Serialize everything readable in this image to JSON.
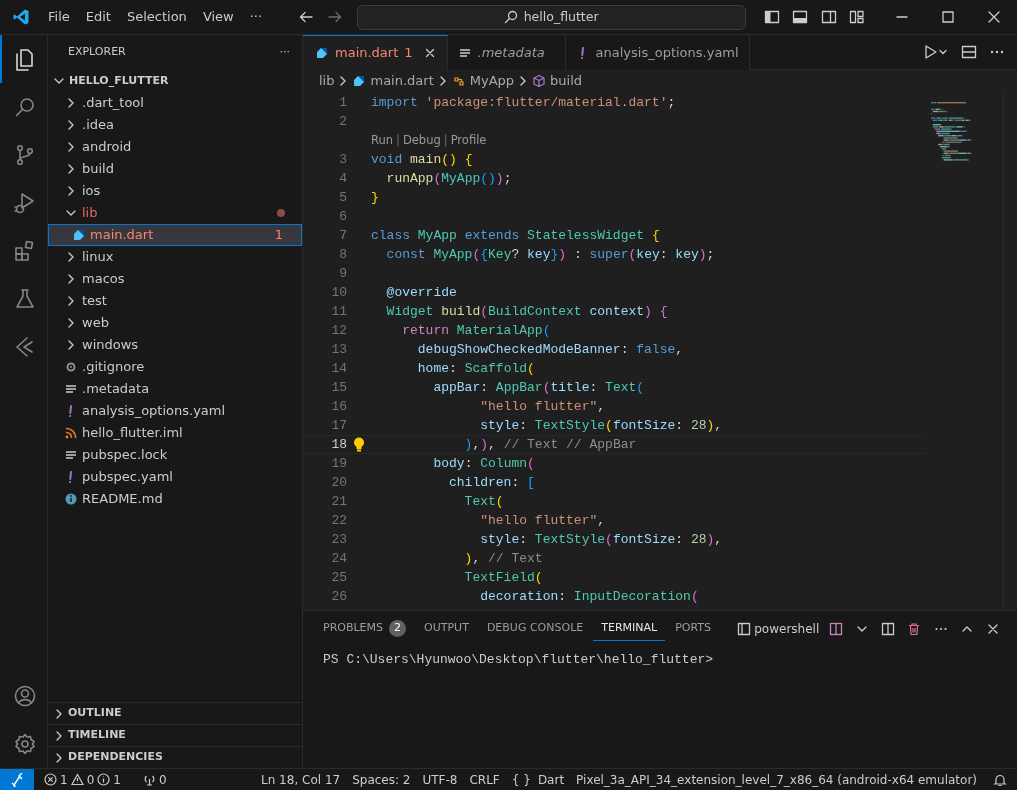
{
  "window": {
    "title": "hello_flutter"
  },
  "menu": [
    "File",
    "Edit",
    "Selection",
    "View"
  ],
  "menu_more": "···",
  "activity_bar": {
    "items": [
      {
        "kind": "explorer",
        "selected": true
      },
      {
        "kind": "search",
        "selected": false
      },
      {
        "kind": "source-control",
        "selected": false
      },
      {
        "kind": "run-debug",
        "selected": false
      },
      {
        "kind": "extensions",
        "selected": false
      },
      {
        "kind": "testing",
        "selected": false
      },
      {
        "kind": "flutter",
        "selected": false
      }
    ],
    "bottom": [
      {
        "kind": "account"
      },
      {
        "kind": "settings"
      }
    ]
  },
  "sidebar": {
    "title": "EXPLORER",
    "more": "···",
    "project": {
      "label": "HELLO_FLUTTER",
      "expanded": true
    },
    "tree": [
      {
        "label": ".dart_tool",
        "kind": "folder",
        "expanded": false,
        "selected": false,
        "error": false
      },
      {
        "label": ".idea",
        "kind": "folder",
        "expanded": false,
        "selected": false,
        "error": false
      },
      {
        "label": "android",
        "kind": "folder",
        "expanded": false,
        "selected": false,
        "error": false
      },
      {
        "label": "build",
        "kind": "folder",
        "expanded": false,
        "selected": false,
        "error": false
      },
      {
        "label": "ios",
        "kind": "folder",
        "expanded": false,
        "selected": false,
        "error": false
      },
      {
        "label": "lib",
        "kind": "folder",
        "expanded": true,
        "selected": false,
        "error": true,
        "children": [
          {
            "label": "main.dart",
            "kind": "dart",
            "selected": true,
            "error": true,
            "badge": "1"
          }
        ]
      },
      {
        "label": "linux",
        "kind": "folder",
        "expanded": false,
        "selected": false,
        "error": false
      },
      {
        "label": "macos",
        "kind": "folder",
        "expanded": false,
        "selected": false,
        "error": false
      },
      {
        "label": "test",
        "kind": "folder",
        "expanded": false,
        "selected": false,
        "error": false
      },
      {
        "label": "web",
        "kind": "folder",
        "expanded": false,
        "selected": false,
        "error": false
      },
      {
        "label": "windows",
        "kind": "folder",
        "expanded": false,
        "selected": false,
        "error": false
      },
      {
        "label": ".gitignore",
        "kind": "config",
        "selected": false,
        "error": false
      },
      {
        "label": ".metadata",
        "kind": "text",
        "selected": false,
        "error": false
      },
      {
        "label": "analysis_options.yaml",
        "kind": "yaml",
        "selected": false,
        "error": false
      },
      {
        "label": "hello_flutter.iml",
        "kind": "feed",
        "selected": false,
        "error": false
      },
      {
        "label": "pubspec.lock",
        "kind": "text",
        "selected": false,
        "error": false
      },
      {
        "label": "pubspec.yaml",
        "kind": "yaml",
        "selected": false,
        "error": false
      },
      {
        "label": "README.md",
        "kind": "readme",
        "selected": false,
        "error": false
      }
    ],
    "sections": [
      {
        "label": "OUTLINE",
        "expanded": false
      },
      {
        "label": "TIMELINE",
        "expanded": false
      },
      {
        "label": "DEPENDENCIES",
        "expanded": false
      }
    ]
  },
  "editor": {
    "tabs": [
      {
        "label": "main.dart",
        "kind": "dart",
        "problems": "1",
        "selected": true,
        "error": true,
        "preview": false
      },
      {
        "label": ".metadata",
        "kind": "text",
        "selected": false,
        "error": false,
        "preview": true
      },
      {
        "label": "analysis_options.yaml",
        "kind": "yaml",
        "selected": false,
        "error": false,
        "preview": false
      }
    ],
    "breadcrumb": [
      {
        "label": "lib",
        "kind": "folder"
      },
      {
        "label": "main.dart",
        "kind": "dart"
      },
      {
        "label": "MyApp",
        "kind": "class"
      },
      {
        "label": "build",
        "kind": "method"
      }
    ],
    "lines": [
      {
        "kind": "code",
        "number": "1",
        "current": false,
        "tokens": [
          {
            "text": "import",
            "kind": "keyword"
          },
          {
            "text": " 'package:flutter/material.dart'",
            "kind": "string"
          },
          {
            "text": ";",
            "kind": "punct"
          }
        ]
      },
      {
        "kind": "code",
        "number": "2",
        "current": false
      },
      {
        "kind": "codelens",
        "items": [
          {
            "text": "Run",
            "kind": "link"
          },
          {
            "text": "|",
            "kind": "separator"
          },
          {
            "text": "Debug",
            "kind": "link"
          },
          {
            "text": "|",
            "kind": "separator"
          },
          {
            "text": "Profile",
            "kind": "link"
          }
        ]
      },
      {
        "kind": "code",
        "number": "3",
        "current": false,
        "tokens": [
          {
            "text": "void",
            "kind": "keyword"
          },
          {
            "text": " main",
            "kind": "function"
          },
          {
            "text": "()",
            "kind": "bracket1"
          },
          {
            "text": " {",
            "kind": "bracket1"
          }
        ]
      },
      {
        "kind": "code",
        "number": "4",
        "current": false,
        "tokens": [
          {
            "text": "  runApp",
            "kind": "function"
          },
          {
            "text": "(",
            "kind": "bracket2"
          },
          {
            "text": "MyApp",
            "kind": "type"
          },
          {
            "text": "()",
            "kind": "bracket3"
          },
          {
            "text": ")",
            "kind": "bracket2"
          },
          {
            "text": ";",
            "kind": "punct"
          }
        ]
      },
      {
        "kind": "code",
        "number": "5",
        "current": false,
        "tokens": [
          {
            "text": "}",
            "kind": "bracket1"
          }
        ]
      },
      {
        "kind": "code",
        "number": "6",
        "current": false
      },
      {
        "kind": "code",
        "number": "7",
        "current": false,
        "tokens": [
          {
            "text": "class",
            "kind": "keyword"
          },
          {
            "text": " MyApp",
            "kind": "type"
          },
          {
            "text": " extends",
            "kind": "keyword"
          },
          {
            "text": " StatelessWidget",
            "kind": "type"
          },
          {
            "text": " {",
            "kind": "bracket1"
          }
        ]
      },
      {
        "kind": "code",
        "number": "8",
        "current": false,
        "tokens": [
          {
            "text": "  const",
            "kind": "keyword"
          },
          {
            "text": " MyApp",
            "kind": "type"
          },
          {
            "text": "(",
            "kind": "bracket2"
          },
          {
            "text": "{",
            "kind": "bracket3"
          },
          {
            "text": "Key",
            "kind": "type"
          },
          {
            "text": "?",
            "kind": "punct"
          },
          {
            "text": " key",
            "kind": "variable"
          },
          {
            "text": "}",
            "kind": "bracket3"
          },
          {
            "text": ")",
            "kind": "bracket2"
          },
          {
            "text": " : ",
            "kind": "punct"
          },
          {
            "text": "super",
            "kind": "keyword"
          },
          {
            "text": "(",
            "kind": "bracket2"
          },
          {
            "text": "key",
            "kind": "variable"
          },
          {
            "text": ": ",
            "kind": "punct"
          },
          {
            "text": "key",
            "kind": "variable"
          },
          {
            "text": ")",
            "kind": "bracket2"
          },
          {
            "text": ";",
            "kind": "punct"
          }
        ]
      },
      {
        "kind": "code",
        "number": "9",
        "current": false
      },
      {
        "kind": "code",
        "number": "10",
        "current": false,
        "tokens": [
          {
            "text": "  @override",
            "kind": "variable"
          }
        ]
      },
      {
        "kind": "code",
        "number": "11",
        "current": false,
        "tokens": [
          {
            "text": "  Widget",
            "kind": "type"
          },
          {
            "text": " build",
            "kind": "function"
          },
          {
            "text": "(",
            "kind": "bracket2"
          },
          {
            "text": "BuildContext",
            "kind": "type"
          },
          {
            "text": " context",
            "kind": "variable"
          },
          {
            "text": ")",
            "kind": "bracket2"
          },
          {
            "text": " {",
            "kind": "bracket2"
          }
        ]
      },
      {
        "kind": "code",
        "number": "12",
        "current": false,
        "tokens": [
          {
            "text": "    return",
            "kind": "control"
          },
          {
            "text": " MaterialApp",
            "kind": "type"
          },
          {
            "text": "(",
            "kind": "bracket3"
          }
        ]
      },
      {
        "kind": "code",
        "number": "13",
        "current": false,
        "tokens": [
          {
            "text": "      debugShowCheckedModeBanner",
            "kind": "variable"
          },
          {
            "text": ": ",
            "kind": "punct"
          },
          {
            "text": "false",
            "kind": "keyword"
          },
          {
            "text": ",",
            "kind": "punct"
          }
        ]
      },
      {
        "kind": "code",
        "number": "14",
        "current": false,
        "tokens": [
          {
            "text": "      home",
            "kind": "variable"
          },
          {
            "text": ": ",
            "kind": "punct"
          },
          {
            "text": "Scaffold",
            "kind": "type"
          },
          {
            "text": "(",
            "kind": "bracket1"
          }
        ]
      },
      {
        "kind": "code",
        "number": "15",
        "current": false,
        "tokens": [
          {
            "text": "        appBar",
            "kind": "variable"
          },
          {
            "text": ": ",
            "kind": "punct"
          },
          {
            "text": "AppBar",
            "kind": "type"
          },
          {
            "text": "(",
            "kind": "bracket2"
          },
          {
            "text": "title",
            "kind": "variable"
          },
          {
            "text": ": ",
            "kind": "punct"
          },
          {
            "text": "Text",
            "kind": "type"
          },
          {
            "text": "(",
            "kind": "bracket3"
          }
        ]
      },
      {
        "kind": "code",
        "number": "16",
        "current": false,
        "tokens": [
          {
            "text": "              \"hello flutter\"",
            "kind": "string"
          },
          {
            "text": ",",
            "kind": "punct"
          }
        ]
      },
      {
        "kind": "code",
        "number": "17",
        "current": false,
        "tokens": [
          {
            "text": "              style",
            "kind": "variable"
          },
          {
            "text": ": ",
            "kind": "punct"
          },
          {
            "text": "TextStyle",
            "kind": "type"
          },
          {
            "text": "(",
            "kind": "bracket1"
          },
          {
            "text": "fontSize",
            "kind": "variable"
          },
          {
            "text": ": ",
            "kind": "punct"
          },
          {
            "text": "28",
            "kind": "number"
          },
          {
            "text": ")",
            "kind": "bracket1"
          },
          {
            "text": ",",
            "kind": "punct"
          }
        ]
      },
      {
        "kind": "code",
        "number": "18",
        "current": true,
        "lightbulb": true,
        "tokens": [
          {
            "text": "            )",
            "kind": "bracket3"
          },
          {
            "text": ",",
            "kind": "punct"
          },
          {
            "text": ")",
            "kind": "bracket2"
          },
          {
            "text": ",",
            "kind": "punct"
          },
          {
            "text": " // Text // AppBar",
            "kind": "comment"
          }
        ]
      },
      {
        "kind": "code",
        "number": "19",
        "current": false,
        "tokens": [
          {
            "text": "        body",
            "kind": "variable"
          },
          {
            "text": ": ",
            "kind": "punct"
          },
          {
            "text": "Column",
            "kind": "type"
          },
          {
            "text": "(",
            "kind": "bracket2"
          }
        ]
      },
      {
        "kind": "code",
        "number": "20",
        "current": false,
        "tokens": [
          {
            "text": "          children",
            "kind": "variable"
          },
          {
            "text": ": ",
            "kind": "punct"
          },
          {
            "text": "[",
            "kind": "bracket3"
          }
        ]
      },
      {
        "kind": "code",
        "number": "21",
        "current": false,
        "tokens": [
          {
            "text": "            Text",
            "kind": "type"
          },
          {
            "text": "(",
            "kind": "bracket1"
          }
        ]
      },
      {
        "kind": "code",
        "number": "22",
        "current": false,
        "tokens": [
          {
            "text": "              \"hello flutter\"",
            "kind": "string"
          },
          {
            "text": ",",
            "kind": "punct"
          }
        ]
      },
      {
        "kind": "code",
        "number": "23",
        "current": false,
        "tokens": [
          {
            "text": "              style",
            "kind": "variable"
          },
          {
            "text": ": ",
            "kind": "punct"
          },
          {
            "text": "TextStyle",
            "kind": "type"
          },
          {
            "text": "(",
            "kind": "bracket2"
          },
          {
            "text": "fontSize",
            "kind": "variable"
          },
          {
            "text": ": ",
            "kind": "punct"
          },
          {
            "text": "28",
            "kind": "number"
          },
          {
            "text": ")",
            "kind": "bracket2"
          },
          {
            "text": ",",
            "kind": "punct"
          }
        ]
      },
      {
        "kind": "code",
        "number": "24",
        "current": false,
        "tokens": [
          {
            "text": "            )",
            "kind": "bracket1"
          },
          {
            "text": ",",
            "kind": "punct"
          },
          {
            "text": " // Text",
            "kind": "comment"
          }
        ]
      },
      {
        "kind": "code",
        "number": "25",
        "current": false,
        "tokens": [
          {
            "text": "            TextField",
            "kind": "type"
          },
          {
            "text": "(",
            "kind": "bracket1"
          }
        ]
      },
      {
        "kind": "code",
        "number": "26",
        "current": false,
        "tokens": [
          {
            "text": "              decoration",
            "kind": "variable"
          },
          {
            "text": ": ",
            "kind": "punct"
          },
          {
            "text": "InputDecoration",
            "kind": "type"
          },
          {
            "text": "(",
            "kind": "bracket2"
          }
        ]
      }
    ]
  },
  "panel": {
    "tabs": [
      {
        "label": "PROBLEMS",
        "count": "2",
        "selected": false
      },
      {
        "label": "OUTPUT",
        "selected": false
      },
      {
        "label": "DEBUG CONSOLE",
        "selected": false
      },
      {
        "label": "TERMINAL",
        "selected": true
      },
      {
        "label": "PORTS",
        "selected": false
      }
    ],
    "terminal_name": "powershell",
    "terminal_lines": [
      "PS C:\\Users\\Hyunwoo\\Desktop\\flutter\\hello_flutter>"
    ]
  },
  "status_bar": {
    "errors": "1",
    "warnings": "0",
    "infos": "1",
    "ports": "0",
    "right": [
      {
        "kind": "text",
        "text": "Ln 18, Col 17"
      },
      {
        "kind": "text",
        "text": "Spaces: 2"
      },
      {
        "kind": "text",
        "text": "UTF-8"
      },
      {
        "kind": "text",
        "text": "CRLF"
      },
      {
        "kind": "language",
        "icon": "{ }",
        "text": "Dart"
      },
      {
        "kind": "text",
        "text": "Pixel_3a_API_34_extension_level_7_x86_64 (android-x64 emulator)"
      }
    ]
  }
}
